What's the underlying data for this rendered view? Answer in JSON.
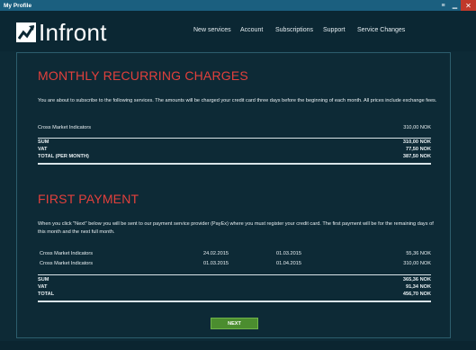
{
  "window": {
    "title": "My Profile",
    "controls": {
      "menu": "≡",
      "minimize": "▁",
      "close": "✕"
    }
  },
  "header": {
    "logo_text": "Infront",
    "nav": [
      "New services",
      "Account",
      "Subscriptions",
      "Support",
      "Service Changes"
    ]
  },
  "monthly": {
    "title": "MONTHLY RECURRING CHARGES",
    "description": "You are about to subscribe to the following services. The amounts will be charged your credit card three days before the beginning of each month. All prices include exchange fees.",
    "items": [
      {
        "name": "Cross Market Indicators",
        "amount": "310,00 NOK"
      }
    ],
    "totals": [
      {
        "label": "SUM",
        "amount": "310,00 NOK"
      },
      {
        "label": "VAT",
        "amount": "77,50 NOK"
      },
      {
        "label": "TOTAL (PER MONTH)",
        "amount": "387,50 NOK"
      }
    ]
  },
  "first": {
    "title": "FIRST PAYMENT",
    "description": "When you click \"Next\" below you will be sent to our payment service provider (PayEx) where you must register your credit card. The first payment will be for the remaining days of this month and the next full month.",
    "items": [
      {
        "name": "Cross Market Indicators",
        "from": "24.02.2015",
        "to": "01.03.2015",
        "amount": "55,36 NOK"
      },
      {
        "name": "Cross Market Indicators",
        "from": "01.03.2015",
        "to": "01.04.2015",
        "amount": "310,00 NOK"
      }
    ],
    "totals": [
      {
        "label": "SUM",
        "amount": "365,36 NOK"
      },
      {
        "label": "VAT",
        "amount": "91,34 NOK"
      },
      {
        "label": "TOTAL",
        "amount": "456,70 NOK"
      }
    ]
  },
  "next_button": "NEXT",
  "colors": {
    "titlebar": "#1b5f7f",
    "background": "#0d2a36",
    "section_title": "#e2403c",
    "next_button": "#4b8d2f",
    "close_button": "#c0392b"
  }
}
